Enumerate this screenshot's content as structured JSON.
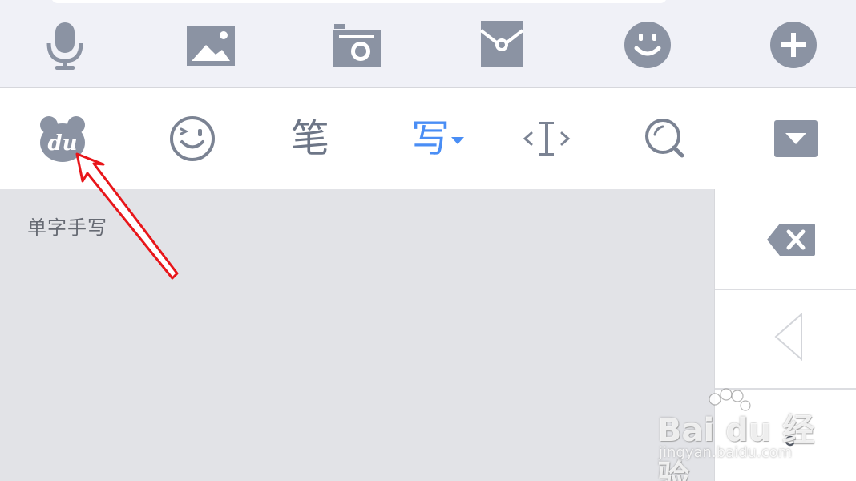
{
  "chat_toolbar": {
    "icons": [
      "microphone-icon",
      "image-icon",
      "camera-icon",
      "red-packet-icon",
      "emoji-icon",
      "plus-icon"
    ]
  },
  "ime_bar": {
    "items": [
      {
        "name": "baidu-logo-icon",
        "text": "du"
      },
      {
        "name": "wink-emoji-icon"
      },
      {
        "name": "stroke-input",
        "text": "笔"
      },
      {
        "name": "handwriting-input",
        "text": "写",
        "active": true
      },
      {
        "name": "cursor-icon"
      },
      {
        "name": "search-icon"
      },
      {
        "name": "collapse-keyboard-icon"
      }
    ]
  },
  "handwriting": {
    "mode_label": "单字手写"
  },
  "side_keys": [
    "backspace-icon",
    "left-arrow-icon",
    "symbol-key"
  ],
  "watermark": {
    "brand": "Bai du 经验",
    "url": "jingyan.baidu.com"
  },
  "colors": {
    "icon_gray": "#8b93a3",
    "active_blue": "#4a8ef5",
    "annotation_red": "#e8161a",
    "toolbar_bg": "#f0f1f7",
    "handwriting_bg": "#e2e3e7"
  }
}
